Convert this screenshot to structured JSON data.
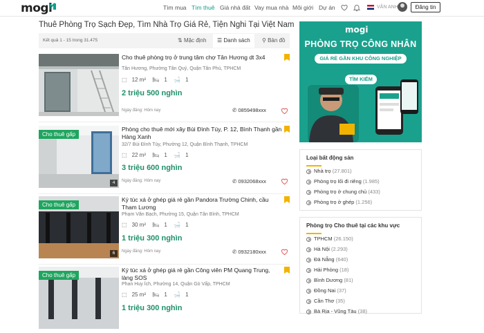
{
  "header": {
    "logo": "mogi",
    "nav": [
      "Tìm mua",
      "Tìm thuê",
      "Giá nhà đất",
      "Vay mua nhà",
      "Môi giới",
      "Dự án"
    ],
    "active_nav": "Tìm thuê",
    "lang_label": "VĂN ANH",
    "login_label": "Đăng tin"
  },
  "page": {
    "title": "Thuê Phòng Trọ Sạch Đẹp, Tìm Nhà Trọ Giá Rẻ, Tiện Nghi Tại Việt Nam",
    "result_count": "Kết quả 1 - 15 trong 31.475",
    "view_options": [
      "Mặc định",
      "Danh sách",
      "Bản đồ"
    ],
    "selected_view": "Danh sách"
  },
  "listings": [
    {
      "title": "Cho thuê phòng trọ ở trung tâm chợ Tân Hương dt 3x4",
      "address": "Tân Hương, Phường Tân Quý, Quận Tân Phú, TPHCM",
      "area": "12 m²",
      "beds": "1",
      "baths": "1",
      "price": "2 triệu 500 nghìn",
      "date": "Ngày đăng: Hôm nay",
      "phone": "0859498xxx",
      "badge": "",
      "photo_count": ""
    },
    {
      "title": "Phòng cho thuê mới xây Bùi Đình Túy, P. 12, Bình Thạnh gần Hàng Xanh",
      "address": "32/7 Bùi Đình Túy, Phường 12, Quận Bình Thạnh, TPHCM",
      "area": "22 m²",
      "beds": "1",
      "baths": "1",
      "price": "3 triệu 600 nghìn",
      "date": "Ngày đăng: Hôm nay",
      "phone": "0932068xxx",
      "badge": "Cho thuê gấp",
      "photo_count": "4"
    },
    {
      "title": "Ký túc xá ở ghép giá rẻ gần Pandora Trường Chinh, cầu Tham Lương",
      "address": "Phạm Văn Bạch, Phường 15, Quận Tân Bình, TPHCM",
      "area": "30 m²",
      "beds": "1",
      "baths": "1",
      "price": "1 triệu 300 nghìn",
      "date": "Ngày đăng: Hôm nay",
      "phone": "0932180xxx",
      "badge": "Cho thuê gấp",
      "photo_count": "6"
    },
    {
      "title": "Ký túc xá ở ghép giá rẻ gần Công viên PM Quang Trung, làng SOS",
      "address": "Phan Huy Ích, Phường 14, Quận Gò Vấp, TPHCM",
      "area": "25 m²",
      "beds": "1",
      "baths": "1",
      "price": "1 triệu 300 nghìn",
      "date": "",
      "phone": "",
      "badge": "Cho thuê gấp",
      "photo_count": ""
    }
  ],
  "banner": {
    "logo": "mogi",
    "title": "PHÒNG TRỌ CÔNG NHÂN",
    "subtitle": "GIÁ RẺ GẦN KHU CÔNG NGHIỆP",
    "button": "TÌM KIẾM"
  },
  "property_types": {
    "title": "Loại bất động sản",
    "items": [
      {
        "label": "Nhà trọ",
        "count": "(27.801)"
      },
      {
        "label": "Phòng trọ lối đi riêng",
        "count": "(1.985)"
      },
      {
        "label": "Phòng trọ ở chung chủ",
        "count": "(433)"
      },
      {
        "label": "Phòng trọ ở ghép",
        "count": "(1.256)"
      }
    ]
  },
  "regions": {
    "title": "Phòng trọ Cho thuê tại các khu vực",
    "items": [
      {
        "label": "TPHCM",
        "count": "(26.150)"
      },
      {
        "label": "Hà Nội",
        "count": "(2.293)"
      },
      {
        "label": "Đà Nẵng",
        "count": "(640)"
      },
      {
        "label": "Hải Phòng",
        "count": "(18)"
      },
      {
        "label": "Bình Dương",
        "count": "(81)"
      },
      {
        "label": "Đồng Nai",
        "count": "(37)"
      },
      {
        "label": "Cần Thơ",
        "count": "(35)"
      },
      {
        "label": "Bà Rịa - Vũng Tàu",
        "count": "(38)"
      }
    ]
  },
  "colors": {
    "brand": "#1aa18d",
    "price": "#1e8f6a",
    "badge": "#1fa55f",
    "bookmark": "#f2b300"
  }
}
